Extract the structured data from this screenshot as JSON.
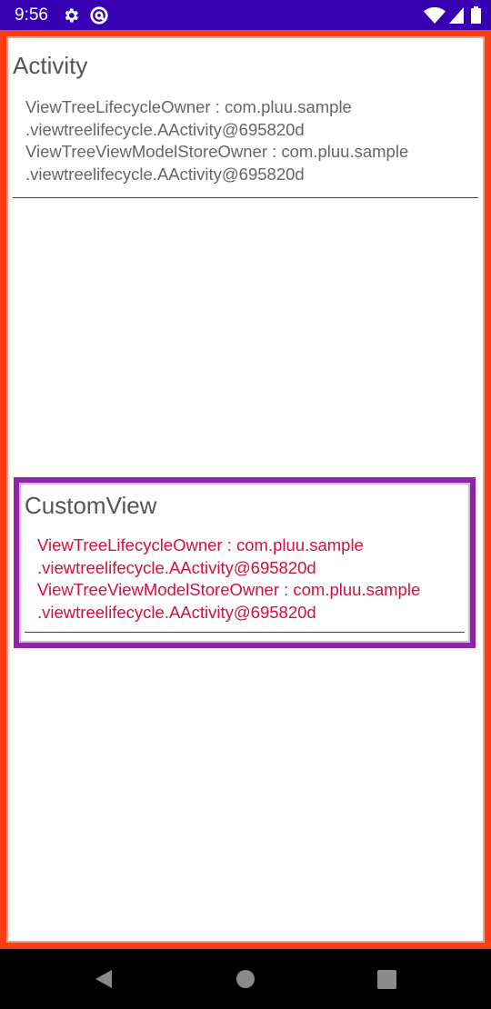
{
  "status_bar": {
    "time": "9:56",
    "background_color": "#3700b3",
    "icons": [
      "gear-icon",
      "at-sign-icon",
      "wifi-icon",
      "signal-icon",
      "battery-icon"
    ]
  },
  "activity": {
    "title": "Activity",
    "border_color": "#ff3d12",
    "text_color": "#666666",
    "lines": [
      "ViewTreeLifecycleOwner : com.pluu.sample",
      ".viewtreelifecycle.AActivity@695820d",
      "ViewTreeViewModelStoreOwner : com.pluu.sample",
      ".viewtreelifecycle.AActivity@695820d"
    ]
  },
  "custom_view": {
    "title": "CustomView",
    "border_color": "#8e24aa",
    "text_color": "#d50f3f",
    "lines": [
      "ViewTreeLifecycleOwner : com.pluu.sample",
      ".viewtreelifecycle.AActivity@695820d",
      "ViewTreeViewModelStoreOwner : com.pluu.sample",
      ".viewtreelifecycle.AActivity@695820d"
    ]
  },
  "nav_bar": {
    "buttons": [
      "back-icon",
      "home-icon",
      "recents-icon"
    ]
  }
}
